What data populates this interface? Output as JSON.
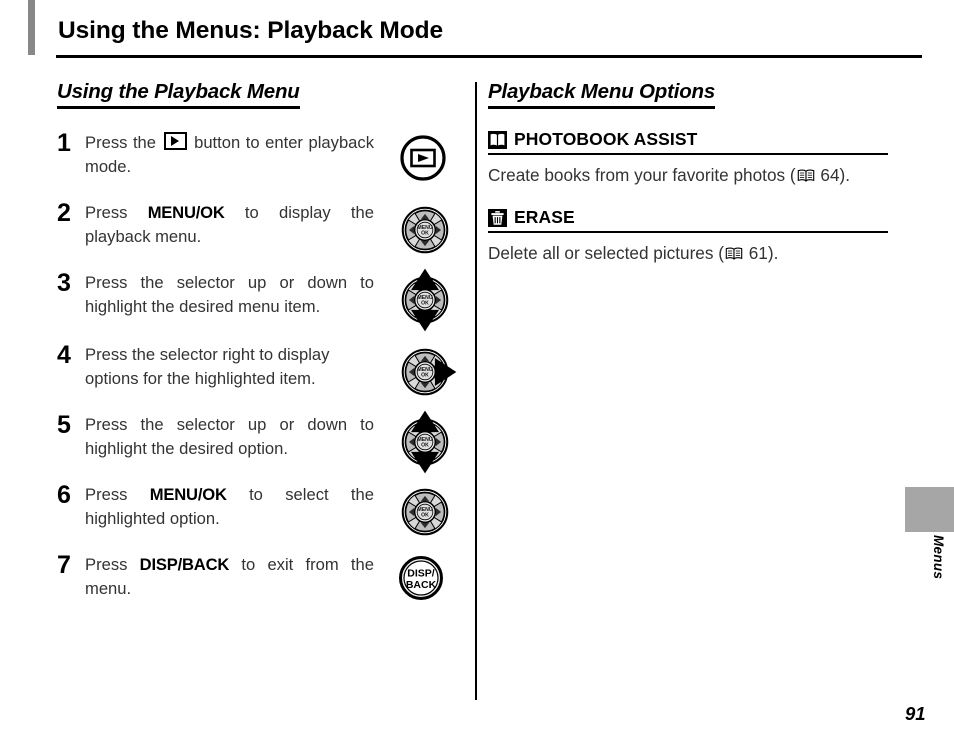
{
  "header": {
    "title": "Using the Menus: Playback Mode"
  },
  "left_column": {
    "heading": "Using the Playback Menu",
    "steps": [
      {
        "number": "1",
        "text_parts": [
          {
            "type": "text",
            "value": "Press the "
          },
          {
            "type": "icon",
            "value": "playback-glyph"
          },
          {
            "type": "text",
            "value": " button to enter playback mode."
          }
        ],
        "plain_text": "Press the ▶ button to enter playback mode.",
        "icon": "playback-button-icon",
        "justify": true
      },
      {
        "number": "2",
        "text_parts": [
          {
            "type": "text",
            "value": "Press "
          },
          {
            "type": "bold",
            "value": "MENU/OK"
          },
          {
            "type": "text",
            "value": " to display the playback menu."
          }
        ],
        "plain_text": "Press MENU/OK to display the playback menu.",
        "icon": "selector-menu-ok-icon",
        "justify": true
      },
      {
        "number": "3",
        "text_parts": [
          {
            "type": "text",
            "value": "Press the selector up or down to highlight the desired menu item."
          }
        ],
        "plain_text": "Press the selector up or down to highlight the desired menu item.",
        "icon": "selector-up-down-icon",
        "justify": true
      },
      {
        "number": "4",
        "text_parts": [
          {
            "type": "text",
            "value": "Press the selector right to display options for the highlighted item."
          }
        ],
        "plain_text": "Press the selector right to display options for the highlighted item.",
        "icon": "selector-right-icon",
        "justify": false
      },
      {
        "number": "5",
        "text_parts": [
          {
            "type": "text",
            "value": "Press the selector up or down to highlight the desired option."
          }
        ],
        "plain_text": "Press the selector up or down to highlight the desired option.",
        "icon": "selector-up-down-icon",
        "justify": true
      },
      {
        "number": "6",
        "text_parts": [
          {
            "type": "text",
            "value": "Press "
          },
          {
            "type": "bold",
            "value": "MENU/OK"
          },
          {
            "type": "text",
            "value": " to select the highlighted option."
          }
        ],
        "plain_text": "Press MENU/OK to select the highlighted option.",
        "icon": "selector-menu-ok-icon",
        "justify": true
      },
      {
        "number": "7",
        "text_parts": [
          {
            "type": "text",
            "value": "Press "
          },
          {
            "type": "bold",
            "value": "DISP/BACK"
          },
          {
            "type": "text",
            "value": " to exit from the menu."
          }
        ],
        "plain_text": "Press DISP/BACK to exit from the menu.",
        "icon": "disp-back-button-icon",
        "justify": true
      }
    ]
  },
  "right_column": {
    "heading": "Playback Menu Options",
    "options": [
      {
        "icon": "open-book-icon",
        "label": "PHOTOBOOK ASSIST",
        "desc_before": "Create books from your favorite photos (",
        "ref_icon": "book-reference-icon",
        "desc_after": " 64)."
      },
      {
        "icon": "trash-can-icon",
        "label": "ERASE",
        "desc_before": "Delete all or selected pictures (",
        "ref_icon": "book-reference-icon",
        "desc_after": " 61)."
      }
    ]
  },
  "footer": {
    "side_tab_label": "Menus",
    "page_number": "91"
  },
  "colors": {
    "accent_gray": "#888888",
    "tab_gray": "#a6a6a6",
    "body_text": "#333333",
    "rule": "#000000"
  },
  "selector_labels": {
    "menu": "MENU",
    "ok": "OK",
    "disp": "DISP/",
    "back": "BACK"
  }
}
